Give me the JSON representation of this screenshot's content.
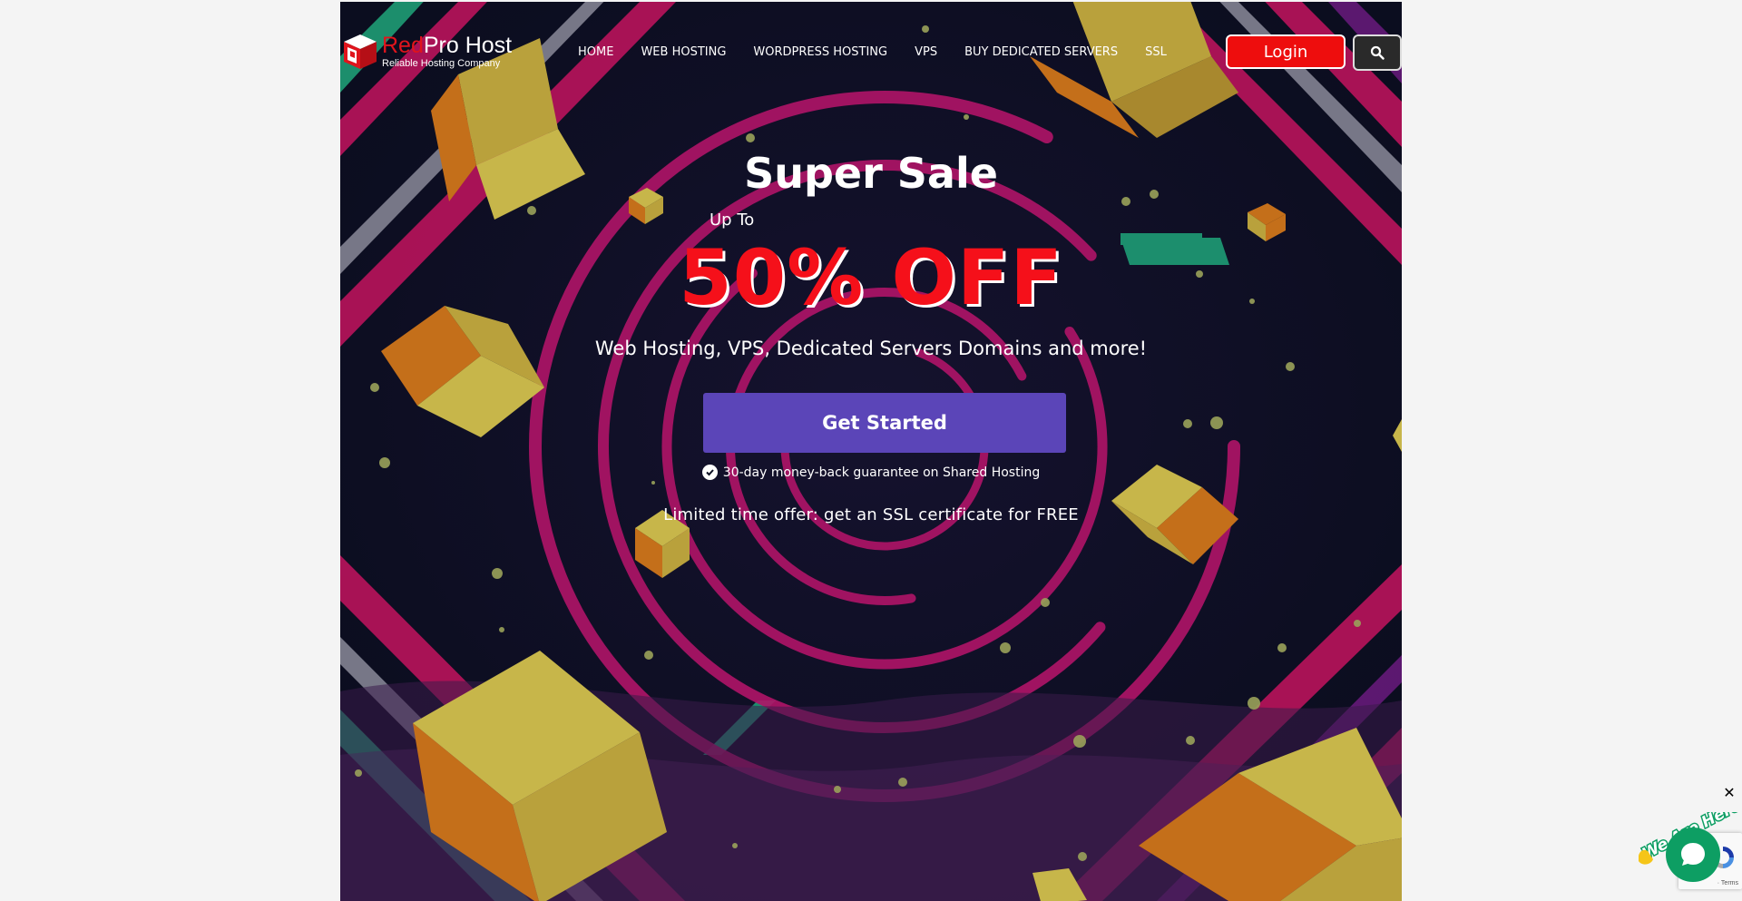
{
  "logo": {
    "brand_red": "Red",
    "brand_white": "Pro Host",
    "tagline": "Reliable Hosting Company"
  },
  "nav": {
    "items": [
      {
        "label": "HOME"
      },
      {
        "label": "WEB HOSTING"
      },
      {
        "label": "WORDPRESS HOSTING"
      },
      {
        "label": "VPS"
      },
      {
        "label": "BUY DEDICATED SERVERS"
      },
      {
        "label": "SSL"
      }
    ],
    "login_label": "Login",
    "search_icon": "search-icon"
  },
  "hero": {
    "title": "Super Sale",
    "upto": "Up To",
    "discount": "50% OFF",
    "subtitle": "Web Hosting, VPS, Dedicated Servers Domains and more!",
    "cta_label": "Get Started",
    "guarantee": "30-day money-back guarantee on Shared Hosting",
    "limited_offer": "Limited time offer: get an SSL certificate for FREE"
  },
  "chat": {
    "close_label": "✕",
    "tagline": "We Are Here!",
    "terms": "· Terms"
  },
  "colors": {
    "accent_red": "#ee0d0d",
    "cta_purple": "#5b45b8",
    "background_dark": "#0d1024",
    "chat_green": "#0d9e63"
  }
}
